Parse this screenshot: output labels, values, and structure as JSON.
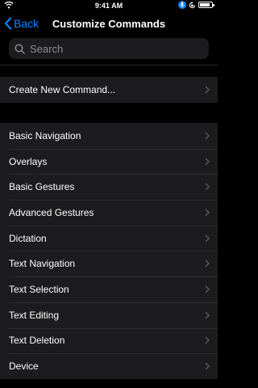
{
  "status_bar": {
    "time": "9:41 AM",
    "battery_level": 0.85
  },
  "nav": {
    "back_label": "Back",
    "title": "Customize Commands"
  },
  "search": {
    "placeholder": "Search"
  },
  "create_group": {
    "label": "Create New Command..."
  },
  "commands": [
    {
      "label": "Basic Navigation"
    },
    {
      "label": "Overlays"
    },
    {
      "label": "Basic Gestures"
    },
    {
      "label": "Advanced Gestures"
    },
    {
      "label": "Dictation"
    },
    {
      "label": "Text Navigation"
    },
    {
      "label": "Text Selection"
    },
    {
      "label": "Text Editing"
    },
    {
      "label": "Text Deletion"
    },
    {
      "label": "Device"
    }
  ],
  "colors": {
    "accent": "#0a84ff",
    "background": "#000000",
    "cell": "#1c1c1e",
    "separator": "#2c2c2e",
    "chevron": "#5a5a5e"
  }
}
